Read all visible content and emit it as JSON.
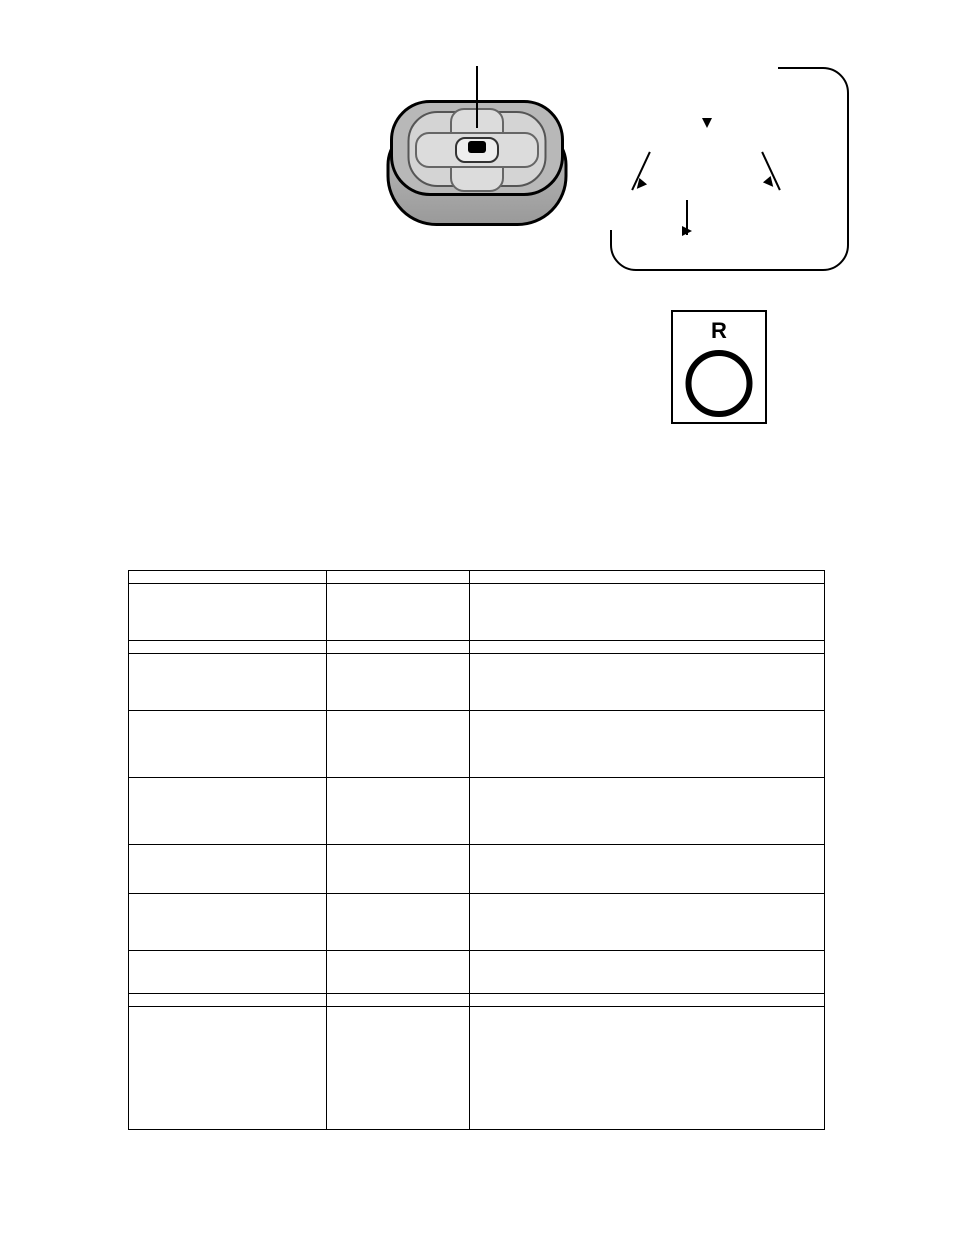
{
  "figure1": {
    "name": "four-way-navigation-knob"
  },
  "figure2": {
    "label": "R",
    "name": "return-button"
  },
  "table": {
    "headers": [
      "",
      "",
      ""
    ],
    "rows": [
      [
        " ",
        " ",
        " "
      ],
      [
        " ",
        " ",
        " "
      ],
      [
        " ",
        " ",
        " "
      ],
      [
        " ",
        " ",
        " "
      ],
      [
        " ",
        " ",
        " "
      ],
      [
        " ",
        " ",
        " "
      ],
      [
        " ",
        " ",
        " "
      ],
      [
        " ",
        " ",
        " "
      ],
      [
        " ",
        " ",
        " "
      ],
      [
        " ",
        " ",
        " "
      ]
    ]
  },
  "pageNumber": ""
}
